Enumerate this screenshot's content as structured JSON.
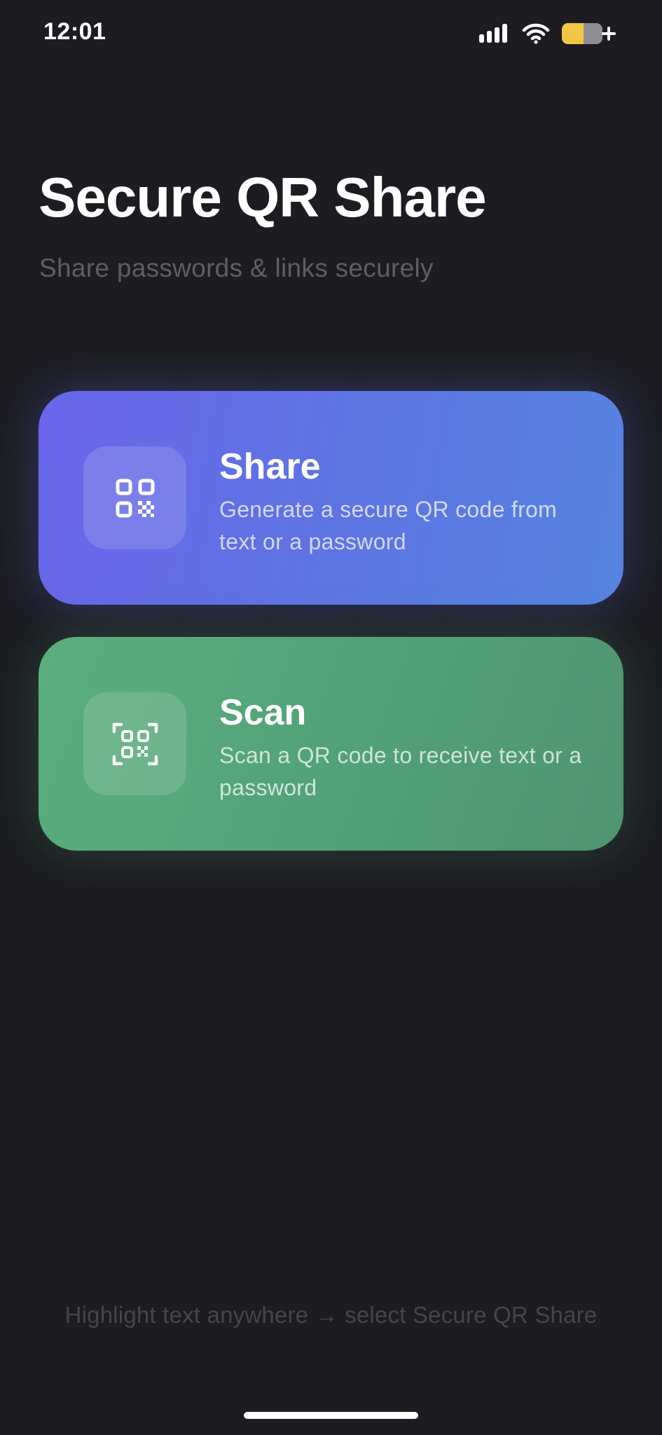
{
  "status_bar": {
    "time": "12:01",
    "icons": [
      "cellular-signal-icon",
      "wifi-icon",
      "battery-charging-icon"
    ]
  },
  "header": {
    "title": "Secure QR Share",
    "subtitle": "Share passwords & links securely"
  },
  "cards": {
    "share": {
      "icon": "qr-code-icon",
      "title": "Share",
      "description": "Generate a secure QR code from text or a password"
    },
    "scan": {
      "icon": "qr-scan-icon",
      "title": "Scan",
      "description": "Scan a QR code to receive text or a password"
    }
  },
  "footer": {
    "hint": "Highlight text anywhere → select Secure QR Share"
  },
  "colors": {
    "background": "#1c1c21",
    "share_card": "#6a66ea",
    "scan_card": "#55a578",
    "battery_level": "#f2c744"
  }
}
